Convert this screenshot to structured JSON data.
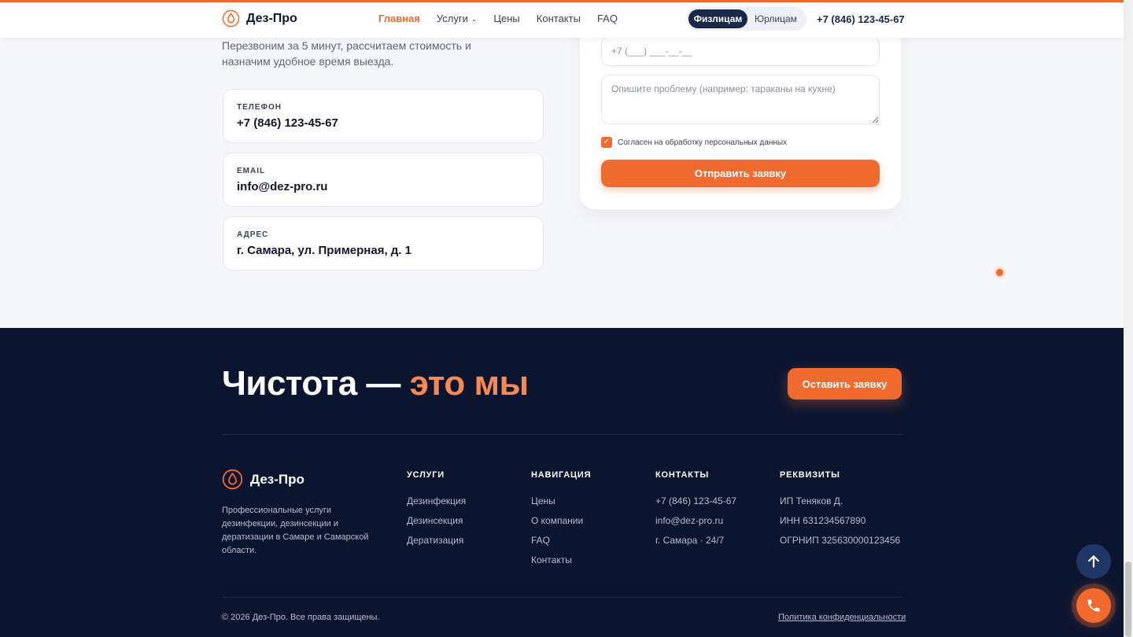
{
  "brand": {
    "name": "Дез-Про",
    "accent_color": "#f26b2e",
    "dark_color": "#0c1530"
  },
  "header": {
    "nav": [
      {
        "label": "Главная",
        "active": true
      },
      {
        "label": "Услуги",
        "dropdown": true
      },
      {
        "label": "Цены"
      },
      {
        "label": "Контакты"
      },
      {
        "label": "FAQ"
      }
    ],
    "segment": {
      "individuals": "Физлицам",
      "companies": "Юрлицам",
      "selected": "Физлицам"
    },
    "phone": "+7 (846) 123-45-67"
  },
  "contact_section": {
    "intro": "Перезвоним за 5 минут, рассчитаем стоимость и назначим удобное время выезда.",
    "cards": [
      {
        "label": "ТЕЛЕФОН",
        "value": "+7 (846) 123-45-67"
      },
      {
        "label": "EMAIL",
        "value": "info@dez-pro.ru"
      },
      {
        "label": "АДРЕС",
        "value": "г. Самара, ул. Примерная, д. 1"
      }
    ]
  },
  "form": {
    "phone_placeholder": "+7 (___) ___-__-__",
    "problem_placeholder": "Опишите проблему (например: тараканы на кухне)",
    "consent_label": "Согласен на обработку персональных данных",
    "consent_checked": true,
    "submit_label": "Отправить заявку"
  },
  "footer": {
    "slogan_main": "Чистота — ",
    "slogan_highlight": "это мы",
    "cta_label": "Оставить заявку",
    "brand_description": "Профессиональные услуги дезинфекции, дезинсекции и дератизации в Самаре и Самарской области.",
    "columns": [
      {
        "title": "УСЛУГИ",
        "items": [
          "Дезинфекция",
          "Дезинсекция",
          "Дератизация"
        ]
      },
      {
        "title": "НАВИГАЦИЯ",
        "items": [
          "Цены",
          "О компании",
          "FAQ",
          "Контакты"
        ]
      },
      {
        "title": "КОНТАКТЫ",
        "items": [
          "+7 (846) 123-45-67",
          "info@dez-pro.ru",
          "г. Самара · 24/7"
        ]
      },
      {
        "title": "РЕКВИЗИТЫ",
        "items": [
          "ИП Теняков Д.",
          "ИНН 631234567890",
          "ОГРНИП 325630000123456"
        ]
      }
    ],
    "copyright": "© 2026 Дез-Про. Все права защищены.",
    "privacy_link": "Политика конфиденциальности"
  },
  "floating": {
    "up_icon": "arrow-up-icon",
    "call_icon": "phone-icon"
  }
}
